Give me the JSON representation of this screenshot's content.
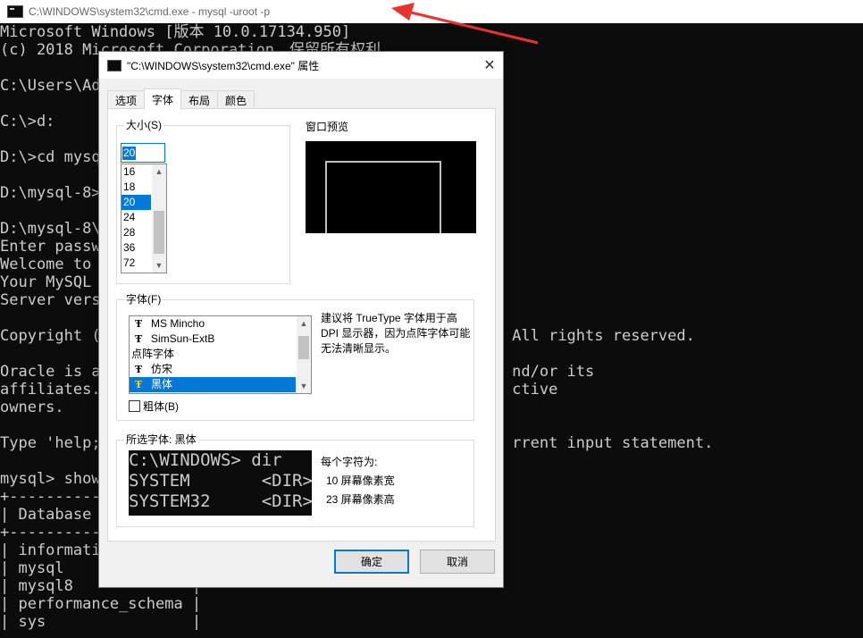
{
  "console": {
    "title": "C:\\WINDOWS\\system32\\cmd.exe - mysql  -uroot -p",
    "lines": [
      "Microsoft Windows [版本 10.0.17134.950]",
      "(c) 2018 Microsoft Corporation。保留所有权利。",
      "",
      "C:\\Users\\Ad",
      "",
      "C:\\>d:",
      "",
      "D:\\>cd mysq",
      "",
      "D:\\mysql-8>",
      "",
      "D:\\mysql-8\\",
      "Enter passw",
      "Welcome to ",
      "Your MySQL ",
      "Server vers",
      "",
      "Copyright (                                             All rights reserved.",
      "",
      "Oracle is a                                             nd/or its",
      "affiliates.                                             ctive",
      "owners.",
      "",
      "Type 'help;                                             rrent input statement.",
      "",
      "mysql> show",
      "+-----------",
      "| Database ",
      "+-----------",
      "| informati",
      "| mysql              |",
      "| mysql8             |",
      "| performance_schema |",
      "| sys                |"
    ]
  },
  "dialog": {
    "title": "\"C:\\WINDOWS\\system32\\cmd.exe\" 属性",
    "close_label": "✕",
    "tabs": [
      {
        "label": "选项",
        "active": false
      },
      {
        "label": "字体",
        "active": true
      },
      {
        "label": "布局",
        "active": false
      },
      {
        "label": "颜色",
        "active": false
      }
    ],
    "size": {
      "group_label": "大小(S)",
      "input_value": "20",
      "items": [
        "16",
        "18",
        "20",
        "24",
        "28",
        "36",
        "72"
      ],
      "selected": "20"
    },
    "preview": {
      "label": "窗口预览"
    },
    "font": {
      "group_label": "字体(F)",
      "items": [
        {
          "label": "MS Mincho",
          "truetype": true,
          "selected": false
        },
        {
          "label": "SimSun-ExtB",
          "truetype": true,
          "selected": false
        },
        {
          "label": "点阵字体",
          "truetype": false,
          "selected": false
        },
        {
          "label": "仿宋",
          "truetype": true,
          "selected": false
        },
        {
          "label": "黑体",
          "truetype": true,
          "selected": true
        }
      ],
      "hint": "建议将 TrueType 字体用于高 DPI 显示器，因为点阵字体可能无法清晰显示。",
      "bold_label": "粗体(B)",
      "bold_checked": false
    },
    "selected_font": {
      "group_label": "所选字体: 黑体",
      "sample_lines": [
        "C:\\WINDOWS> dir",
        "SYSTEM       <DIR>",
        "SYSTEM32     <DIR>"
      ],
      "charinfo_label": "每个字符为:",
      "width_text": "10 屏幕像素宽",
      "height_text": "23 屏幕像素高"
    },
    "ok_label": "确定",
    "cancel_label": "取消"
  },
  "colors": {
    "console_bg": "#0c0c0c",
    "console_text": "#cccccc",
    "selection": "#0078d7",
    "annotation_arrow": "#e8322d"
  },
  "icons": {
    "console_app": "cmd-icon",
    "truetype": "truetype-font-icon",
    "annotation": "red-arrow-icon"
  }
}
